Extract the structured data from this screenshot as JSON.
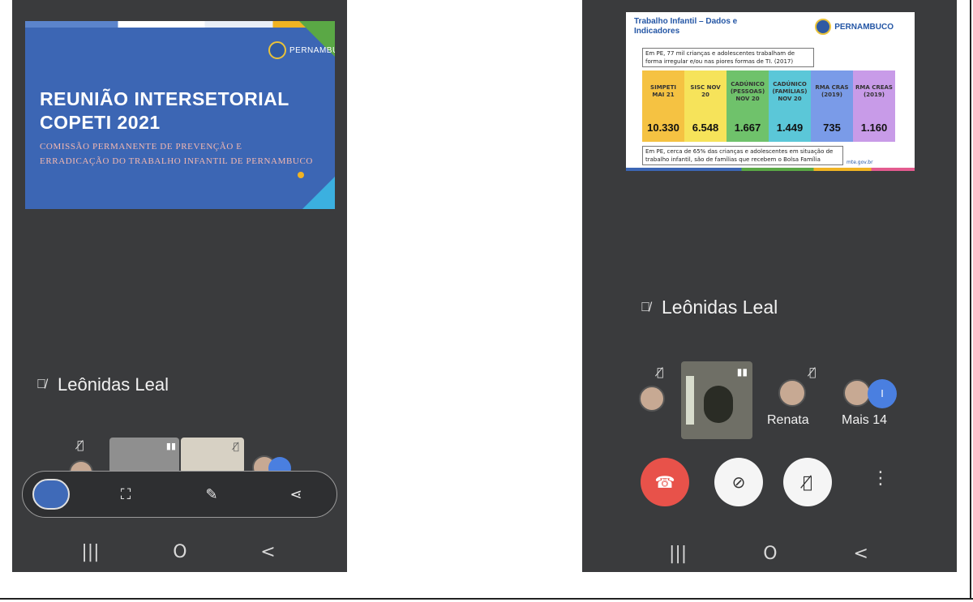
{
  "left_phone": {
    "slide": {
      "title_line1": "REUNIÃO INTERSETORIAL",
      "title_line2": "COPETI 2021",
      "subtitle_line1": "COMISSÃO PERMANENTE DE PREVENÇÃO E",
      "subtitle_line2": "ERRADICAÇÃO DO TRABALHO INFANTIL DE PERNAMBUCO",
      "logo_text": "PERNAMBUCO"
    },
    "speaker": {
      "mic_icon": "mic-off-icon",
      "name": "Leônidas Leal"
    },
    "toolbar": {
      "icons": [
        "scroll-capture-icon",
        "crop-edit-icon",
        "share-icon"
      ]
    }
  },
  "right_phone": {
    "slide": {
      "header_line1": "Trabalho Infantil – Dados e",
      "header_line2": "Indicadores",
      "logo_text": "PERNAMBUCO",
      "intro_line1": "Em PE, 77 mil crianças e adolescentes trabalham de",
      "intro_line2": "forma irregular e/ou nas piores formas de TI. (2017)",
      "table": [
        {
          "header": "SIMPETI MAI 21",
          "value": "10.330",
          "color": "#f5c242"
        },
        {
          "header": "SISC NOV 20",
          "value": "6.548",
          "color": "#f6e35a"
        },
        {
          "header": "CADÚNICO (PESSOAS) NOV 20",
          "value": "1.667",
          "color": "#6fc26b"
        },
        {
          "header": "CADÚNICO (FAMÍLIAS) NOV 20",
          "value": "1.449",
          "color": "#5bc7d8"
        },
        {
          "header": "RMA CRAS (2019)",
          "value": "735",
          "color": "#7a9be8"
        },
        {
          "header": "RMA CREAS (2019)",
          "value": "1.160",
          "color": "#c89be8"
        }
      ],
      "footer_line1": "Em PE, cerca de 65% das crianças e adolescentes em situação de",
      "footer_line2": "trabalho infantil, são de famílias que recebem o Bolsa Família",
      "url": "mte.gov.br"
    },
    "speaker": {
      "mic_icon": "mic-off-icon",
      "name": "Leônidas Leal"
    },
    "participants": {
      "renata": "Renata",
      "more": "Mais 14",
      "more_badge": "I"
    },
    "controls": {
      "end_call_icon": "phone-end-icon",
      "camera_icon": "camera-off-icon",
      "mic_icon": "mic-off-icon",
      "more_icon": "more-vertical-icon"
    }
  },
  "system_nav": {
    "recents": "|||",
    "home": "O",
    "back": "<"
  },
  "colors": {
    "phone_bg": "#3a3b3d",
    "slide_blue": "#3c66b4",
    "end_call": "#e8524a"
  }
}
